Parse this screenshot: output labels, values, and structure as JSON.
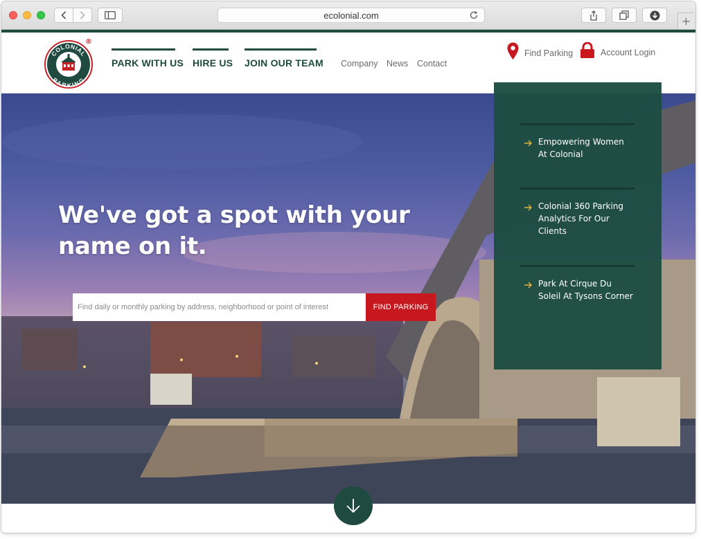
{
  "browser": {
    "url": "ecolonial.com"
  },
  "logo": {
    "text_top": "COLONIAL",
    "text_bottom": "PARKING",
    "registered": "®",
    "colors": {
      "red": "#c62127",
      "green": "#1f4a40"
    }
  },
  "nav": {
    "main": [
      "PARK WITH US",
      "HIRE US",
      "JOIN OUR TEAM"
    ],
    "secondary": [
      "Company",
      "News",
      "Contact"
    ],
    "find_parking": "Find Parking",
    "account_login": "Account Login"
  },
  "hero": {
    "title_line1": "We've got a spot with your",
    "title_line2": "name on it.",
    "search_placeholder": "Find daily or monthly parking by address, neighborhood or point of interest",
    "search_button": "FIND PARKING"
  },
  "news": [
    {
      "title": "Empowering Women At Colonial"
    },
    {
      "title": "Colonial 360 Parking Analytics For Our Clients"
    },
    {
      "title": "Park At Cirque Du Soleil At Tysons Corner"
    }
  ],
  "colors": {
    "brand_green": "#1f4a40",
    "brand_red": "#c8181f",
    "arrow_yellow": "#e3b53b"
  },
  "icons": [
    "back-icon",
    "forward-icon",
    "sidebar-icon",
    "reload-icon",
    "share-icon",
    "tabs-icon",
    "download-icon",
    "map-pin-icon",
    "lock-icon",
    "arrow-right-icon",
    "arrow-down-icon"
  ]
}
